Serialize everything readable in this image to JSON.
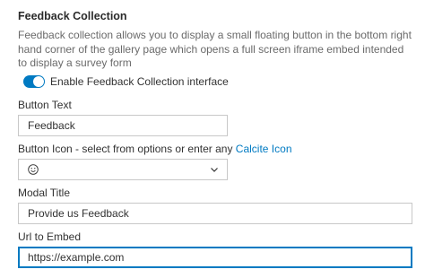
{
  "section": {
    "title": "Feedback Collection",
    "description": "Feedback collection allows you to display a small floating button in the bottom right hand corner of the gallery page which opens a full screen iframe embed intended to display a survey form"
  },
  "toggle": {
    "label": "Enable Feedback Collection interface",
    "checked": true,
    "accent": "#007ac2"
  },
  "button_text": {
    "label": "Button Text",
    "value": "Feedback"
  },
  "button_icon": {
    "label_prefix": "Button Icon - select from options or enter any ",
    "link_text": "Calcite Icon",
    "selected_icon": "smiley-icon"
  },
  "modal_title": {
    "label": "Modal Title",
    "value": "Provide us Feedback"
  },
  "url_embed": {
    "label": "Url to Embed",
    "value": "https://example.com"
  }
}
